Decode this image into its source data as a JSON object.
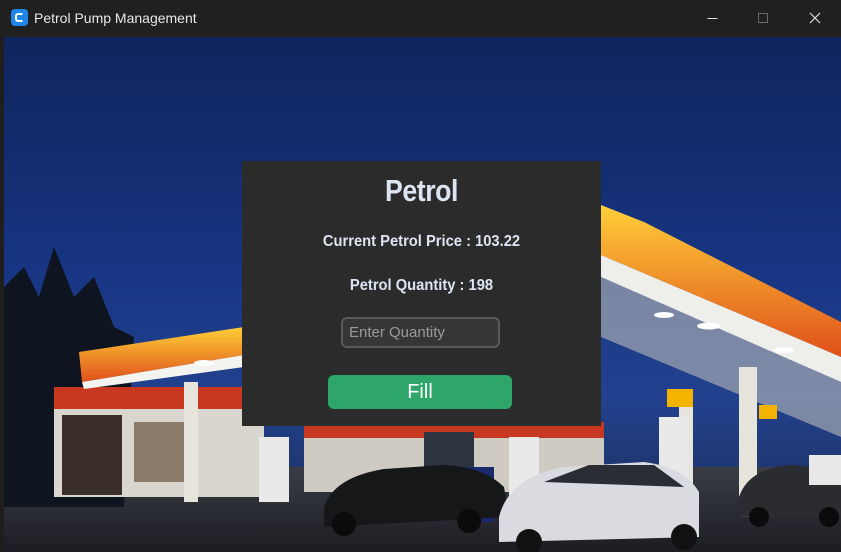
{
  "window": {
    "title": "Petrol Pump Management",
    "icon": "app-icon",
    "controls": {
      "minimize": "minimize-icon",
      "maximize": "maximize-icon",
      "close": "close-icon"
    }
  },
  "panel": {
    "heading": "Petrol",
    "price_line": "Current Petrol Price : 103.22",
    "quantity_line": "Petrol Quantity : 198",
    "quantity_input": {
      "placeholder": "Enter Quantity",
      "value": ""
    },
    "fill_button": "Fill"
  },
  "colors": {
    "panel_bg": "#2b2b2b",
    "text": "#dce4f2",
    "button": "#2ea66a",
    "titlebar": "#202020"
  }
}
